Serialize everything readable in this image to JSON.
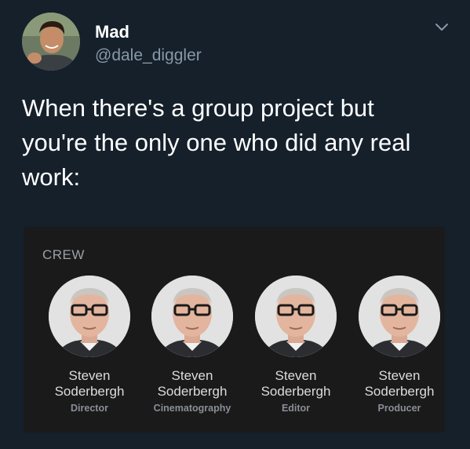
{
  "tweet": {
    "author": {
      "display_name": "Mad",
      "handle": "@dale_diggler"
    },
    "menu_icon": "chevron-down-icon",
    "text_lines": [
      "When there's a group project but",
      "you're the only one who did any real",
      "work:"
    ]
  },
  "media": {
    "section_label": "CREW",
    "crew": [
      {
        "first_name": "Steven",
        "last_name": "Soderbergh",
        "role": "Director"
      },
      {
        "first_name": "Steven",
        "last_name": "Soderbergh",
        "role": "Cinematography"
      },
      {
        "first_name": "Steven",
        "last_name": "Soderbergh",
        "role": "Editor"
      },
      {
        "first_name": "Steven",
        "last_name": "Soderbergh",
        "role": "Producer"
      }
    ]
  },
  "colors": {
    "background": "#15202b",
    "secondary_text": "#8899a6",
    "card_background": "#1a1a1b"
  }
}
